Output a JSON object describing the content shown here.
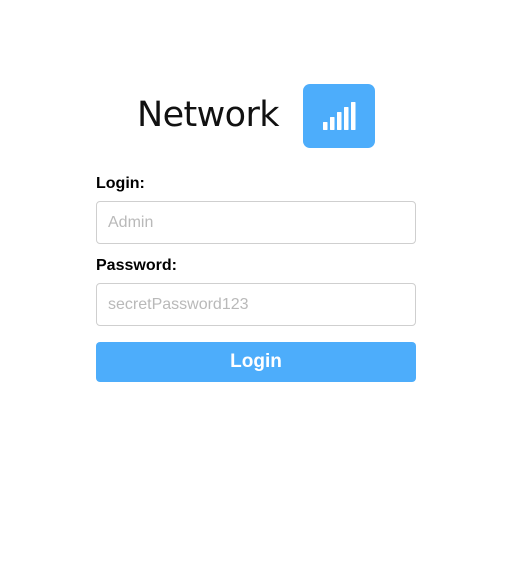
{
  "brand": {
    "name": "Network",
    "icon": "signal-bars-icon"
  },
  "login_form": {
    "login_label": "Login:",
    "login_placeholder": "Admin",
    "password_label": "Password:",
    "password_placeholder": "secretPassword123",
    "submit_label": "Login"
  },
  "colors": {
    "accent": "#4dadfb",
    "text": "#000000",
    "input_border": "#cfcfcf",
    "placeholder": "#b9b9b9"
  }
}
